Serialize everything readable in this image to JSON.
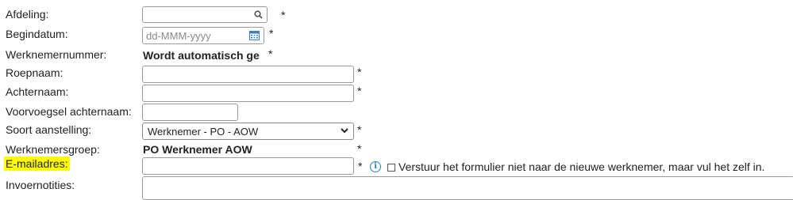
{
  "form": {
    "afdeling": {
      "label": "Afdeling:",
      "value": "",
      "required": "*",
      "icon": "search-icon"
    },
    "begindatum": {
      "label": "Begindatum:",
      "placeholder": "dd-MMM-yyyy",
      "required": "*",
      "icon": "calendar-icon"
    },
    "werknemernummer": {
      "label": "Werknemernummer:",
      "value": "Wordt automatisch ge",
      "required": "*"
    },
    "roepnaam": {
      "label": "Roepnaam:",
      "value": "",
      "required": "*"
    },
    "achternaam": {
      "label": "Achternaam:",
      "value": "",
      "required": "*"
    },
    "voorvoegsel": {
      "label": "Voorvoegsel achternaam:",
      "value": ""
    },
    "soort_aanstelling": {
      "label": "Soort aanstelling:",
      "selected": "Werknemer - PO - AOW",
      "required": "*"
    },
    "werknemersgroep": {
      "label": "Werknemersgroep:",
      "value": "PO Werknemer AOW",
      "required": "*"
    },
    "email": {
      "label": "E-mailadres:",
      "value": "",
      "required": "*",
      "highlight_color": "#fefe00",
      "info_icon": "info-icon",
      "info_glyph": "i",
      "checkbox_checked": false,
      "checkbox_label": "Verstuur het formulier niet naar de nieuwe werknemer, maar vul het zelf in."
    },
    "invoernotities": {
      "label": "Invoernotities:",
      "value": ""
    }
  },
  "colors": {
    "accent": "#2a7fd4",
    "border": "#9a9a9a"
  }
}
